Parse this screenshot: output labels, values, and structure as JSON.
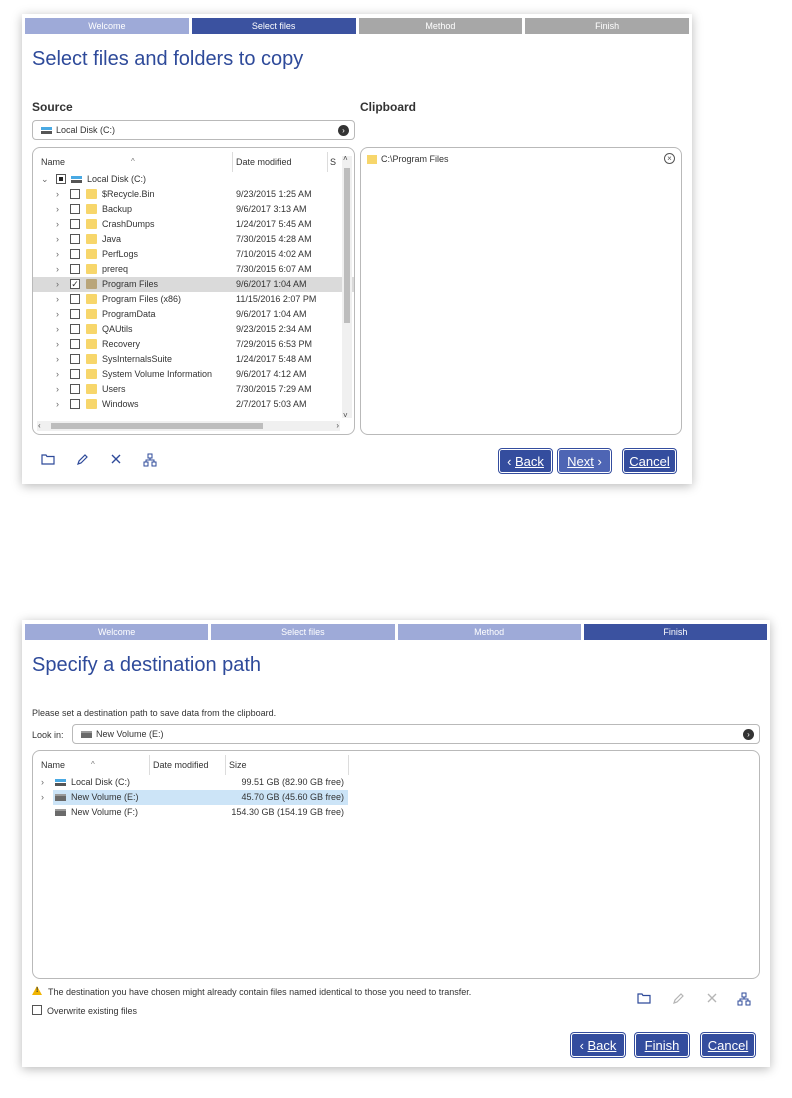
{
  "wizard1": {
    "steps": [
      "Welcome",
      "Select files",
      "Method",
      "Finish"
    ],
    "title": "Select files and folders to copy",
    "source_label": "Source",
    "clipboard_label": "Clipboard",
    "source_path": "Local Disk (C:)",
    "tree_columns": {
      "name": "Name",
      "date": "Date modified",
      "size": "S"
    },
    "root": {
      "name": "Local Disk (C:)"
    },
    "rows": [
      {
        "name": "$Recycle.Bin",
        "date": "9/23/2015 1:25 AM",
        "checked": false,
        "selected": false
      },
      {
        "name": "Backup",
        "date": "9/6/2017 3:13 AM",
        "checked": false,
        "selected": false
      },
      {
        "name": "CrashDumps",
        "date": "1/24/2017 5:45 AM",
        "checked": false,
        "selected": false
      },
      {
        "name": "Java",
        "date": "7/30/2015 4:28 AM",
        "checked": false,
        "selected": false
      },
      {
        "name": "PerfLogs",
        "date": "7/10/2015 4:02 AM",
        "checked": false,
        "selected": false
      },
      {
        "name": "prereq",
        "date": "7/30/2015 6:07 AM",
        "checked": false,
        "selected": false
      },
      {
        "name": "Program Files",
        "date": "9/6/2017 1:04 AM",
        "checked": true,
        "selected": true
      },
      {
        "name": "Program Files (x86)",
        "date": "11/15/2016 2:07 PM",
        "checked": false,
        "selected": false
      },
      {
        "name": "ProgramData",
        "date": "9/6/2017 1:04 AM",
        "checked": false,
        "selected": false
      },
      {
        "name": "QAUtils",
        "date": "9/23/2015 2:34 AM",
        "checked": false,
        "selected": false
      },
      {
        "name": "Recovery",
        "date": "7/29/2015 6:53 PM",
        "checked": false,
        "selected": false
      },
      {
        "name": "SysInternalsSuite",
        "date": "1/24/2017 5:48 AM",
        "checked": false,
        "selected": false
      },
      {
        "name": "System Volume Information",
        "date": "9/6/2017 4:12 AM",
        "checked": false,
        "selected": false
      },
      {
        "name": "Users",
        "date": "7/30/2015 7:29 AM",
        "checked": false,
        "selected": false
      },
      {
        "name": "Windows",
        "date": "2/7/2017 5:03 AM",
        "checked": false,
        "selected": false
      }
    ],
    "clipboard_items": [
      "C:\\Program Files"
    ],
    "buttons": {
      "back": "Back",
      "next": "Next",
      "cancel": "Cancel"
    }
  },
  "wizard2": {
    "steps": [
      "Welcome",
      "Select files",
      "Method",
      "Finish"
    ],
    "title": "Specify a destination path",
    "instruction": "Please set a destination path to save data from the clipboard.",
    "look_in_label": "Look in:",
    "look_in_value": "New Volume (E:)",
    "columns": {
      "name": "Name",
      "date": "Date modified",
      "size": "Size"
    },
    "drives": [
      {
        "name": "Local Disk (C:)",
        "size": "99.51 GB (82.90 GB free)",
        "expandable": true,
        "highlighted": false,
        "icon": "windows-drive-icon"
      },
      {
        "name": "New Volume (E:)",
        "size": "45.70 GB (45.60 GB free)",
        "expandable": true,
        "highlighted": true,
        "icon": "drive-icon"
      },
      {
        "name": "New Volume (F:)",
        "size": "154.30 GB (154.19 GB free)",
        "expandable": false,
        "highlighted": false,
        "icon": "drive-icon"
      }
    ],
    "warning": "The destination you have chosen might already contain files named identical to those you need to transfer.",
    "overwrite_label": "Overwrite existing files",
    "buttons": {
      "back": "Back",
      "finish": "Finish",
      "cancel": "Cancel"
    }
  },
  "colors": {
    "accent": "#3b52a0",
    "step_done": "#9eaad8",
    "step_todo": "#a7a7a7",
    "title": "#2e4a9a",
    "warning": "#f1b400",
    "highlight": "#cce4f7"
  }
}
